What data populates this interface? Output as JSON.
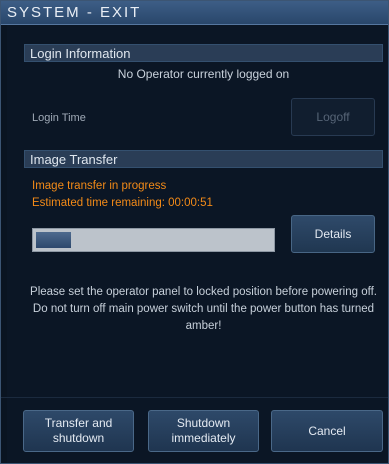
{
  "window": {
    "title": "SYSTEM - EXIT"
  },
  "login": {
    "section_title": "Login Information",
    "operator_status": "No Operator currently logged on",
    "login_time_label": "Login Time",
    "logoff_label": "Logoff",
    "logoff_enabled": false
  },
  "transfer": {
    "section_title": "Image Transfer",
    "status": "Image transfer in progress",
    "time_remaining": "Estimated time remaining: 00:00:51",
    "progress_fraction": 0.15,
    "details_label": "Details"
  },
  "message": "Please set the operator panel to locked position before powering off. Do not turn off main power switch until the power button has turned amber!",
  "buttons": {
    "transfer_and_shutdown": "Transfer and\nshutdown",
    "shutdown_immediately": "Shutdown\nimmediately",
    "cancel": "Cancel"
  },
  "colors": {
    "status_text": "#f28a18",
    "title_bar": "#34557c",
    "section_header": "#2a3d56",
    "background": "#0b1625"
  }
}
